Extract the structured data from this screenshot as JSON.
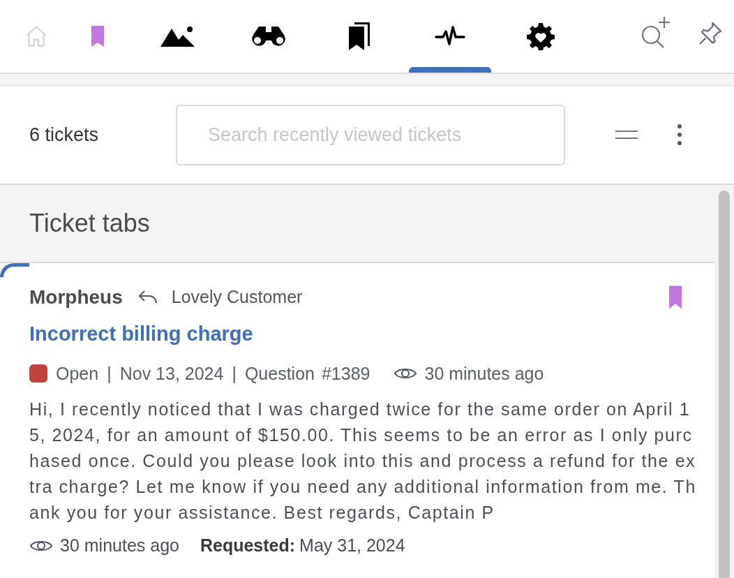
{
  "nav_tabs": [
    {
      "kind": "home",
      "selected": false,
      "disabled": true
    },
    {
      "kind": "bookmark",
      "selected": false,
      "disabled": false
    },
    {
      "kind": "mountains",
      "selected": false,
      "disabled": false
    },
    {
      "kind": "binoculars",
      "selected": false,
      "disabled": false
    },
    {
      "kind": "bookmarks",
      "selected": false,
      "disabled": false
    },
    {
      "kind": "activity",
      "selected": true,
      "disabled": false
    },
    {
      "kind": "gear-heart",
      "selected": false,
      "disabled": false
    }
  ],
  "toolbar_tools": [
    {
      "kind": "search-plus"
    },
    {
      "kind": "pin"
    }
  ],
  "header": {
    "count": "6 tickets",
    "search": {
      "placeholder": "Search recently viewed tickets"
    }
  },
  "section": {
    "title": "Ticket tabs"
  },
  "tickets": [
    {
      "active": true,
      "author": "Morpheus",
      "recipient": "Lovely Customer",
      "bookmarked": true,
      "title": "Incorrect billing charge",
      "status": {
        "label": "Open",
        "color": "#c0423f"
      },
      "separator_1": "|",
      "date": "Nov 13, 2024",
      "separator_2": "|",
      "type": "Question",
      "number": "#1389",
      "viewed": "30 minutes ago",
      "preview": "Hi, I recently noticed that I was charged twice for the same order on April 15, 2024, for an amount of $150.00. This seems to be an error as I only purchased once. Could you please look into this and process a refund for the extra charge? Let me know if you need any additional information from me. Thank you for your assistance. Best regards, Captain P",
      "footer_viewed": "30 minutes ago",
      "requested_label": "Requested:",
      "requested_date": "May 31, 2024"
    }
  ]
}
